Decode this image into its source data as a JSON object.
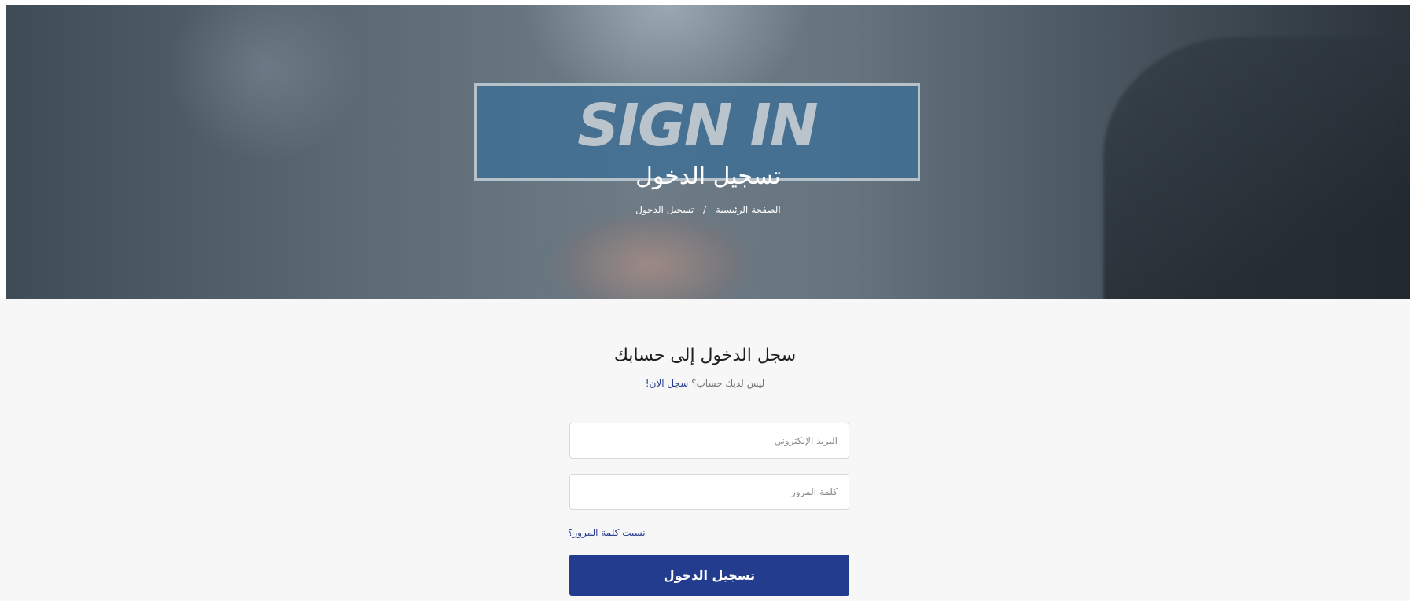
{
  "hero": {
    "logo_text": "SIGN IN",
    "title": "تسجيل الدخول",
    "breadcrumb": {
      "home": "الصفحة الرئيسية",
      "separator": "/",
      "current": "تسجيل الدخول"
    }
  },
  "login_form": {
    "heading": "سجل الدخول إلى حسابك",
    "subtitle_prefix": "ليس لديك حساب؟",
    "signup_link": "سجل الآن!",
    "email_placeholder": "البريد الإلكتروني",
    "password_placeholder": "كلمة المرور",
    "forgot_password": "نسيت كلمة المرور؟",
    "submit_label": "تسجيل الدخول"
  },
  "colors": {
    "primary_button": "#233c8e",
    "link": "#2a3f8f",
    "content_bg": "#f7f7f7"
  }
}
